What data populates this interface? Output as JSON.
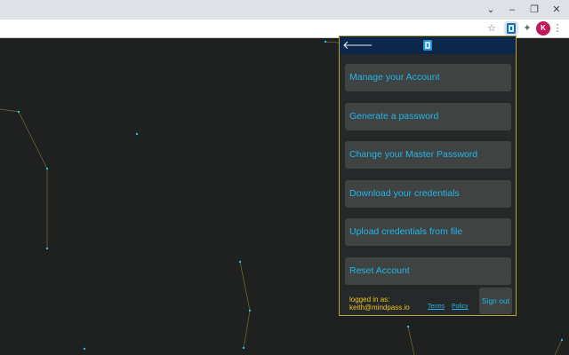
{
  "window": {
    "controls": {
      "dropdown": "⌄",
      "minimize": "–",
      "restore": "❐",
      "close": "✕"
    }
  },
  "toolbar": {
    "star": "☆",
    "extension_icon": "mindpass-extension-icon",
    "puzzle": "✦",
    "avatar_initial": "K",
    "more": "⋮"
  },
  "popup": {
    "back_arrow": "🡐",
    "menu": [
      {
        "label": "Manage your Account"
      },
      {
        "label": "Generate a password"
      },
      {
        "label": "Change your Master Password"
      },
      {
        "label": "Download your credentials"
      },
      {
        "label": "Upload credentials from file"
      },
      {
        "label": "Reset Account"
      }
    ],
    "footer": {
      "logged_in_label": "logged in as:",
      "email": "keith@mindpass.io",
      "terms": "Terms",
      "policy": "Policy",
      "sign_out": "Sign out"
    }
  },
  "colors": {
    "accent": "#23b6ea",
    "user_text": "#f0c419",
    "popup_border": "#b9a23d",
    "header": "#0c2749",
    "button_bg": "#3f4341"
  }
}
